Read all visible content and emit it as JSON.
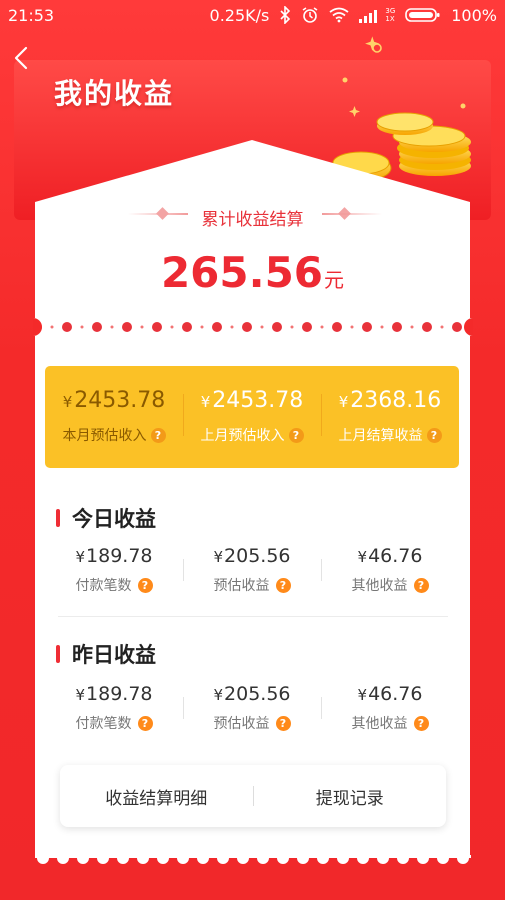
{
  "status_bar": {
    "time": "21:53",
    "speed": "0.25K/s",
    "network": "3G",
    "sim": "1X",
    "battery": "100%"
  },
  "header": {
    "title": "我的收益"
  },
  "summary": {
    "label": "累计收益结算",
    "amount": "265.56",
    "unit": "元"
  },
  "monthly": [
    {
      "currency": "¥",
      "value": "2453.78",
      "label": "本月预估收入"
    },
    {
      "currency": "¥",
      "value": "2453.78",
      "label": "上月预估收入"
    },
    {
      "currency": "¥",
      "value": "2368.16",
      "label": "上月结算收益"
    }
  ],
  "today": {
    "title": "今日收益",
    "stats": [
      {
        "currency": "¥",
        "value": "189.78",
        "label": "付款笔数"
      },
      {
        "currency": "¥",
        "value": "205.56",
        "label": "预估收益"
      },
      {
        "currency": "¥",
        "value": "46.76",
        "label": "其他收益"
      }
    ]
  },
  "yesterday": {
    "title": "昨日收益",
    "stats": [
      {
        "currency": "¥",
        "value": "189.78",
        "label": "付款笔数"
      },
      {
        "currency": "¥",
        "value": "205.56",
        "label": "预估收益"
      },
      {
        "currency": "¥",
        "value": "46.76",
        "label": "其他收益"
      }
    ]
  },
  "actions": {
    "detail_label": "收益结算明细",
    "withdraw_label": "提现记录"
  },
  "help_glyph": "?",
  "colors": {
    "accent_red": "#ed2a33",
    "card_yellow": "#fbc126",
    "help_orange": "#ff8a1a"
  }
}
